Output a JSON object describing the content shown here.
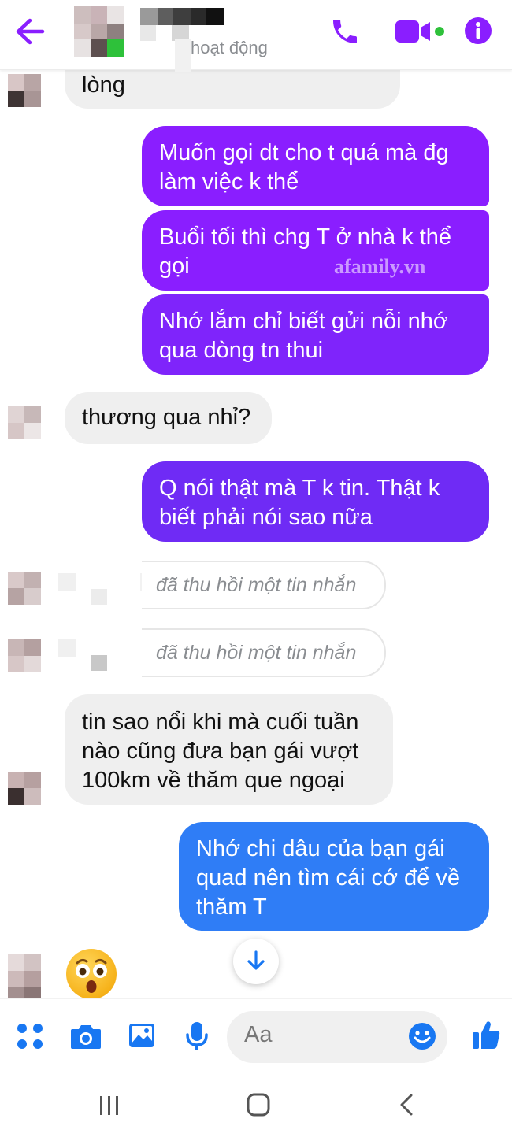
{
  "header": {
    "status_text": "hoạt động",
    "back_icon": "back-arrow-icon",
    "call_icon": "phone-icon",
    "video_icon": "video-camera-icon",
    "info_icon": "info-icon",
    "accent": "#8a1eff"
  },
  "messages": {
    "m0": "lòng",
    "m1_line1": "Muốn gọi dt cho t quá mà đg",
    "m1_line2": "làm việc k thể",
    "m2_line1": "Buổi tối thì chg T ở nhà k thể",
    "m2_line2": "gọi",
    "m3_line1": "Nhớ lắm chỉ biết gửi nỗi nhớ",
    "m3_line2": "qua dòng tn thui",
    "m4": "thương qua nhỉ?",
    "m5_line1": "Q nói thật mà T k tin. Thật k",
    "m5_line2": "biết phải nói sao nữa",
    "recalled1": "đã thu hồi một tin nhắn",
    "recalled2": "đã thu hồi một tin nhắn",
    "m6_line1": "tin sao nổi khi mà cuối tuần",
    "m6_line2": "nào cũng đưa bạn gái vượt",
    "m6_line3": "100km về thăm que ngoại",
    "m7_line1": "Nhớ chi dâu của bạn gái",
    "m7_line2": "quad nên tìm cái cớ để về",
    "m7_line3": "thăm T",
    "reaction_emoji": "astonished-face-icon"
  },
  "watermark": "afamily.vn",
  "composer": {
    "placeholder": "Aa",
    "icons": [
      "menu-dots-icon",
      "camera-icon",
      "image-icon",
      "microphone-icon",
      "emoji-icon",
      "thumbs-up-icon"
    ]
  },
  "colors": {
    "received_bg": "#efefef",
    "sent_purple": "#8a1eff",
    "sent_indigo": "#6f2bf5",
    "sent_blue": "#2f7df6",
    "icon_blue": "#1877f2"
  }
}
